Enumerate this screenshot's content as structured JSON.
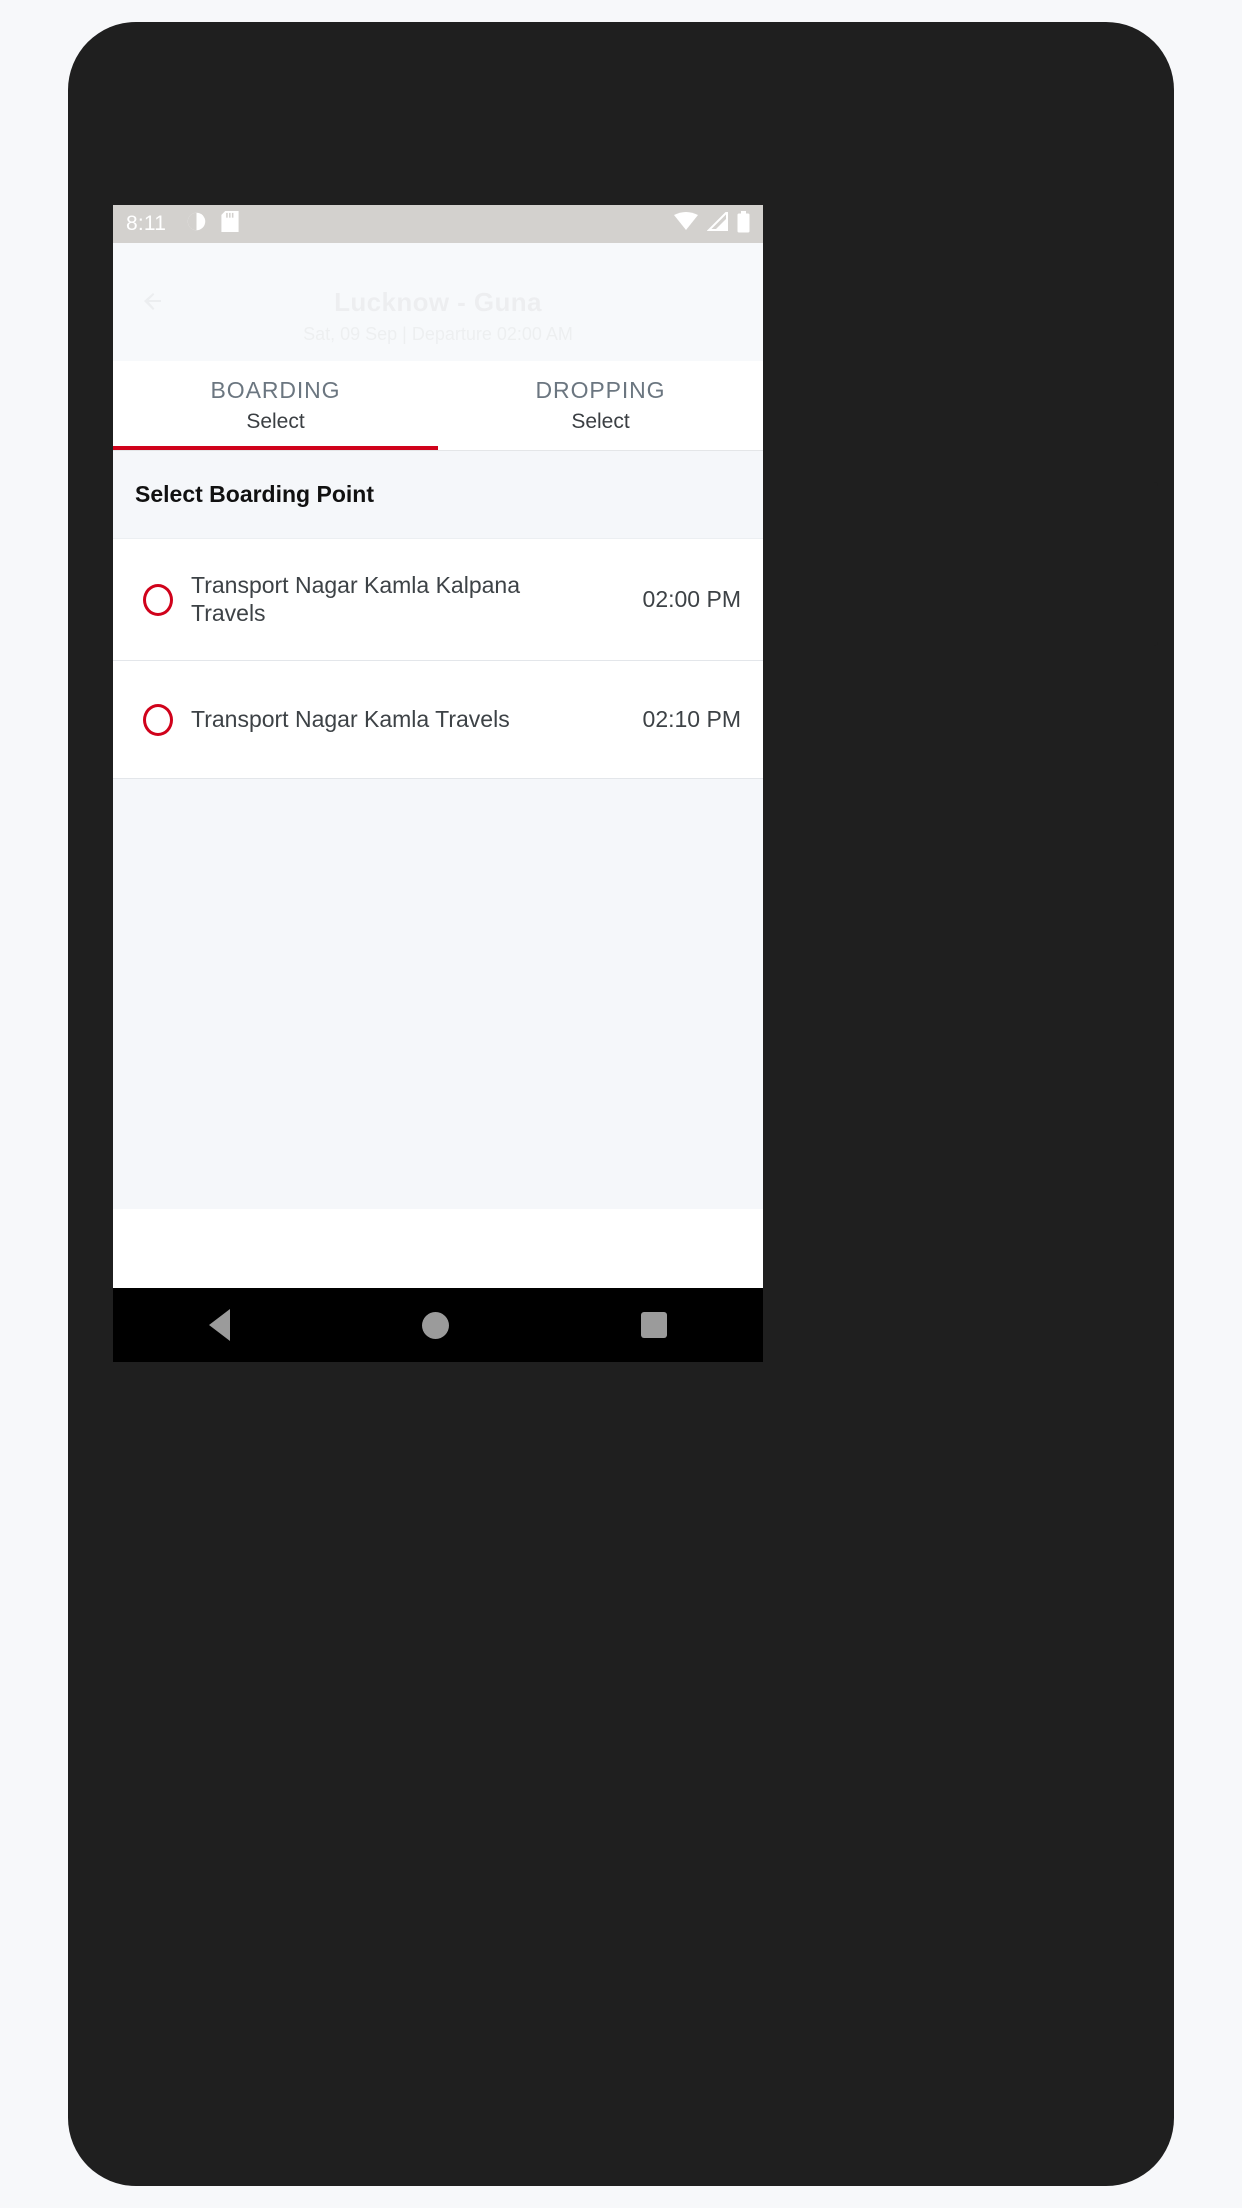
{
  "status_bar": {
    "time": "8:11",
    "left_icons": [
      "do-not-disturb-icon",
      "sd-card-icon"
    ],
    "right_icons": [
      "wifi-icon",
      "cellular-signal-icon",
      "battery-icon"
    ]
  },
  "header": {
    "back_icon": "back-arrow-icon",
    "route": "Lucknow - Guna",
    "subtitle": "Sat, 09 Sep | Departure 02:00 AM"
  },
  "tabs": [
    {
      "title": "BOARDING",
      "subtitle": "Select",
      "active": true
    },
    {
      "title": "DROPPING",
      "subtitle": "Select",
      "active": false
    }
  ],
  "section": {
    "heading": "Select Boarding Point"
  },
  "boarding_points": [
    {
      "name": "Transport Nagar Kamla Kalpana Travels",
      "time": "02:00 PM",
      "selected": false
    },
    {
      "name": "Transport Nagar Kamla Travels",
      "time": "02:10 PM",
      "selected": false
    }
  ],
  "nav_bar": {
    "back": "back-triangle-icon",
    "home": "home-circle-icon",
    "recents": "recents-square-icon"
  },
  "colors": {
    "accent_red": "#d0021b",
    "status_bar": "#d3d1ce",
    "page_bg": "#f5f7fa",
    "frame": "#1f1f1f"
  }
}
